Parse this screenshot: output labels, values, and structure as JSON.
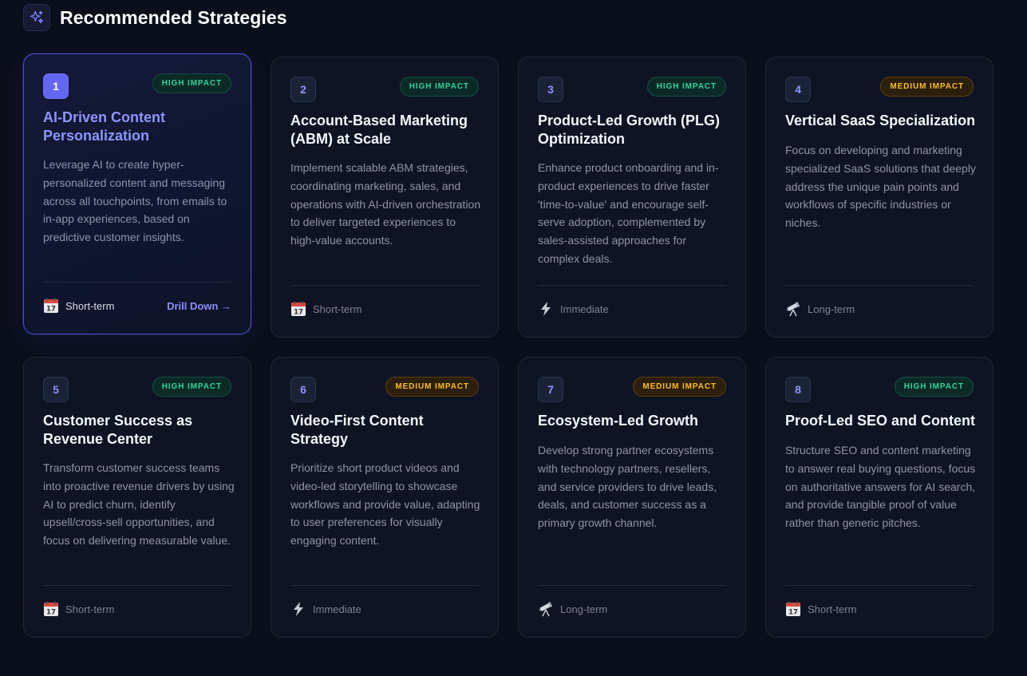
{
  "header": {
    "title": "Recommended Strategies",
    "icon": "sparkles-icon"
  },
  "strategies": [
    {
      "number": "1",
      "impact": "HIGH IMPACT",
      "impact_level": "high",
      "title": "AI-Driven Content Personalization",
      "description": "Leverage AI to create hyper-personalized content and messaging across all touchpoints, from emails to in-app experiences, based on predictive customer insights.",
      "term": "Short-term",
      "term_icon": "calendar-icon",
      "action": "Drill Down →",
      "active": true
    },
    {
      "number": "2",
      "impact": "HIGH IMPACT",
      "impact_level": "high",
      "title": "Account-Based Marketing (ABM) at Scale",
      "description": "Implement scalable ABM strategies, coordinating marketing, sales, and operations with AI-driven orchestration to deliver targeted experiences to high-value accounts.",
      "term": "Short-term",
      "term_icon": "calendar-icon"
    },
    {
      "number": "3",
      "impact": "HIGH IMPACT",
      "impact_level": "high",
      "title": "Product-Led Growth (PLG) Optimization",
      "description": "Enhance product onboarding and in-product experiences to drive faster 'time-to-value' and encourage self-serve adoption, complemented by sales-assisted approaches for complex deals.",
      "term": "Immediate",
      "term_icon": "lightning-icon"
    },
    {
      "number": "4",
      "impact": "MEDIUM IMPACT",
      "impact_level": "medium",
      "title": "Vertical SaaS Specialization",
      "description": "Focus on developing and marketing specialized SaaS solutions that deeply address the unique pain points and workflows of specific industries or niches.",
      "term": "Long-term",
      "term_icon": "telescope-icon"
    },
    {
      "number": "5",
      "impact": "HIGH IMPACT",
      "impact_level": "high",
      "title": "Customer Success as Revenue Center",
      "description": "Transform customer success teams into proactive revenue drivers by using AI to predict churn, identify upsell/cross-sell opportunities, and focus on delivering measurable value.",
      "term": "Short-term",
      "term_icon": "calendar-icon"
    },
    {
      "number": "6",
      "impact": "MEDIUM IMPACT",
      "impact_level": "medium",
      "title": "Video-First Content Strategy",
      "description": "Prioritize short product videos and video-led storytelling to showcase workflows and provide value, adapting to user preferences for visually engaging content.",
      "term": "Immediate",
      "term_icon": "lightning-icon"
    },
    {
      "number": "7",
      "impact": "MEDIUM IMPACT",
      "impact_level": "medium",
      "title": "Ecosystem-Led Growth",
      "description": "Develop strong partner ecosystems with technology partners, resellers, and service providers to drive leads, deals, and customer success as a primary growth channel.",
      "term": "Long-term",
      "term_icon": "telescope-icon"
    },
    {
      "number": "8",
      "impact": "HIGH IMPACT",
      "impact_level": "high",
      "title": "Proof-Led SEO and Content",
      "description": "Structure SEO and content marketing to answer real buying questions, focus on authoritative answers for AI search, and provide tangible proof of value rather than generic pitches.",
      "term": "Short-term",
      "term_icon": "calendar-icon"
    }
  ]
}
